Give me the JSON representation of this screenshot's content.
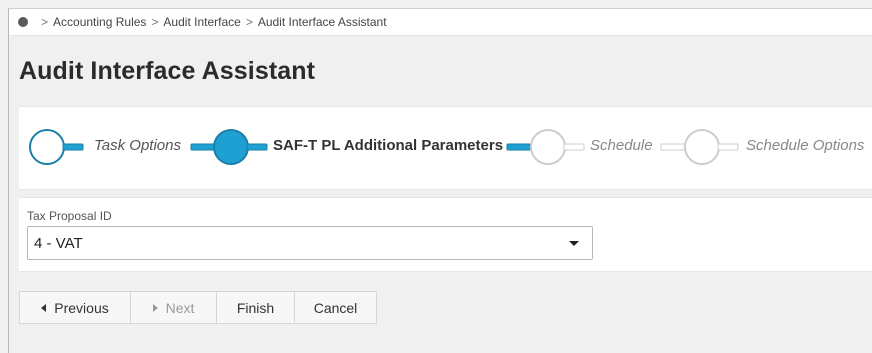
{
  "breadcrumb": {
    "items": [
      "Accounting Rules",
      "Audit Interface",
      "Audit Interface Assistant"
    ],
    "separator": ">"
  },
  "page": {
    "title": "Audit Interface Assistant"
  },
  "steps": [
    {
      "label": "Task Options",
      "state": "completed"
    },
    {
      "label": "SAF-T PL Additional Parameters",
      "state": "active"
    },
    {
      "label": "Schedule",
      "state": "pending"
    },
    {
      "label": "Schedule Options",
      "state": "pending"
    }
  ],
  "form": {
    "tax_proposal_label": "Tax Proposal ID",
    "tax_proposal_value": "4 - VAT"
  },
  "buttons": {
    "previous": "Previous",
    "next": "Next",
    "finish": "Finish",
    "cancel": "Cancel"
  },
  "colors": {
    "accent": "#1ea0d2",
    "accent_border": "#1b7fa8",
    "pending": "#cccccc"
  }
}
